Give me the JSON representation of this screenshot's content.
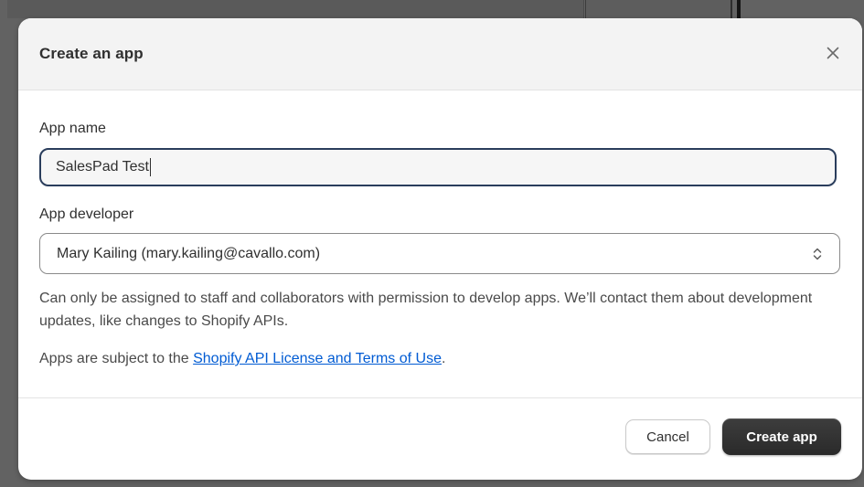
{
  "dialog": {
    "title": "Create an app",
    "close_icon": "close-icon"
  },
  "form": {
    "app_name": {
      "label": "App name",
      "value": "SalesPad Test"
    },
    "app_developer": {
      "label": "App developer",
      "selected": "Mary Kailing (mary.kailing@cavallo.com)",
      "icon": "select-chevrons-icon",
      "help_text": "Can only be assigned to staff and collaborators with permission to develop apps. We’ll contact them about development updates, like changes to Shopify APIs."
    },
    "terms": {
      "prefix": "Apps are subject to the ",
      "link_text": "Shopify API License and Terms of Use",
      "suffix": "."
    }
  },
  "footer": {
    "cancel_label": "Cancel",
    "create_label": "Create app"
  },
  "colors": {
    "primary_button": "#303030",
    "link": "#005bd3",
    "focus_border": "#2a3d5c"
  }
}
